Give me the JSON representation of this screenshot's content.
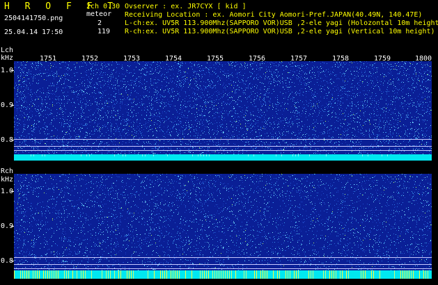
{
  "header": {
    "title": "H R O F F T",
    "version": "2ch 0.30",
    "filename": "2504141750.png",
    "datetime": "25.04.14 17:50",
    "meteor_label": "meteor",
    "lch_count": "2",
    "rch_count": "119",
    "observer": "Ovserver            : ex. JR7CYX [ kid ]",
    "location": "Receiving Location : ex. Aomori City Aomori-Pref.JAPAN(40.49N, 140.47E)",
    "lch_info": "L-ch:ex. UV5R 113.900Mhz(SAPPORO VOR)USB ,2-ele yagi (Holozontal 10m height)",
    "rch_info": "R-ch:ex. UV5R 113.900Mhz(SAPPORO VOR)USB ,2-ele yagi (Vertical 10m height)"
  },
  "axis": {
    "time_ticks": [
      "1751",
      "1752",
      "1753",
      "1754",
      "1755",
      "1756",
      "1757",
      "1758",
      "1759",
      "1800"
    ],
    "lch_label": "Lch",
    "rch_label": "Rch",
    "khz_label": "kHz",
    "freq_labels": [
      "1.0",
      "0.9",
      "0.8"
    ]
  },
  "colors": {
    "background": "#000000",
    "spectrogram_bg": "#0a1f96",
    "noise_band": "#00ffff",
    "text_yellow": "#ffff00",
    "text_white": "#ffffff"
  }
}
